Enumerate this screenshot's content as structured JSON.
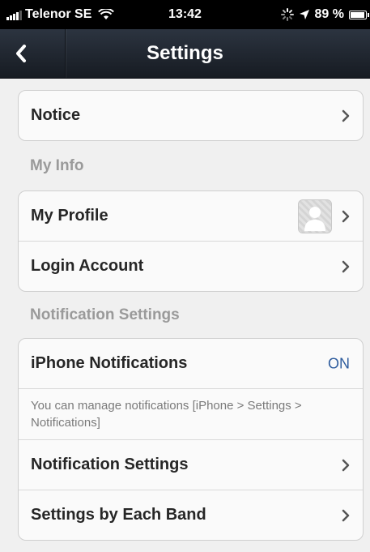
{
  "status_bar": {
    "carrier": "Telenor SE",
    "time": "13:42",
    "battery": "89 %",
    "battery_level": 0.89,
    "icons": [
      "signal-icon",
      "wifi-icon",
      "activity-icon",
      "location-arrow-icon",
      "battery-icon"
    ]
  },
  "nav": {
    "title": "Settings",
    "back_icon": "chevron-left-icon"
  },
  "groups": {
    "notice": {
      "label": "Notice"
    },
    "my_info": {
      "header": "My Info",
      "profile": "My Profile",
      "login": "Login Account"
    },
    "notifications": {
      "header": "Notification Settings",
      "iphone": "iPhone Notifications",
      "iphone_value": "ON",
      "help": "You can manage notifications [iPhone > Settings > Notifications]",
      "settings": "Notification Settings",
      "by_band": "Settings by Each Band"
    }
  },
  "colors": {
    "nav_bar": "#1f252e",
    "background": "#f0f0f0",
    "accent": "#2f5d9e",
    "section_header": "#9a9a9a"
  }
}
